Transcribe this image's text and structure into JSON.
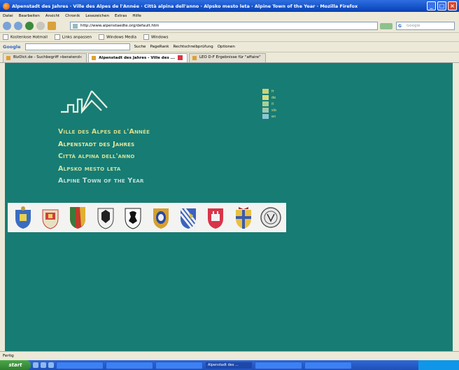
{
  "window": {
    "title": "Alpenstadt des Jahres · Ville des Alpes de l'Année · Città alpina dell'anno · Alpsko mesto leta · Alpine Town of the Year · Mozilla Firefox"
  },
  "menu": [
    "Datei",
    "Bearbeiten",
    "Ansicht",
    "Chronik",
    "Lesezeichen",
    "Extras",
    "Hilfe"
  ],
  "nav": {
    "url": "http://www.alpenstaedte.org/default.htm",
    "search_placeholder": "Google"
  },
  "bookmarks": [
    "Kostenlose Hotmail",
    "Links anpassen",
    "Windows Media",
    "Windows"
  ],
  "googlebar": {
    "logo": "Google",
    "items": [
      "Suche",
      "PageRank",
      "Rechtschreibprüfung",
      "Optionen"
    ]
  },
  "tabs": [
    {
      "label": "BizDict.de - Suchbegriff »beratend«"
    },
    {
      "label": "Alpenstadt des Jahres - Ville des ..."
    },
    {
      "label": "LEO D-F Ergebnisse für \"affaire\""
    }
  ],
  "page": {
    "titles": [
      "Ville des Alpes de l'Année",
      "Alpenstadt des Jahres",
      "Città alpina dell'anno",
      "Alpsko mesto leta",
      "Alpine Town of the Year"
    ],
    "languages": [
      {
        "code": "fr",
        "color": "#c8d27a"
      },
      {
        "code": "de",
        "color": "#d6dc80"
      },
      {
        "code": "it",
        "color": "#a8d098"
      },
      {
        "code": "slo",
        "color": "#9ccab0"
      },
      {
        "code": "en",
        "color": "#8cc6d8"
      }
    ],
    "crests": [
      "crest-1",
      "crest-2",
      "crest-3",
      "crest-4",
      "crest-5",
      "crest-6",
      "crest-7",
      "crest-8",
      "crest-9",
      "crest-10"
    ]
  },
  "status": "Fertig",
  "taskbar": {
    "start": "start",
    "tasks": [
      "",
      "",
      "",
      "Alpenstadt des ...",
      "",
      "",
      ""
    ],
    "clock": ""
  }
}
